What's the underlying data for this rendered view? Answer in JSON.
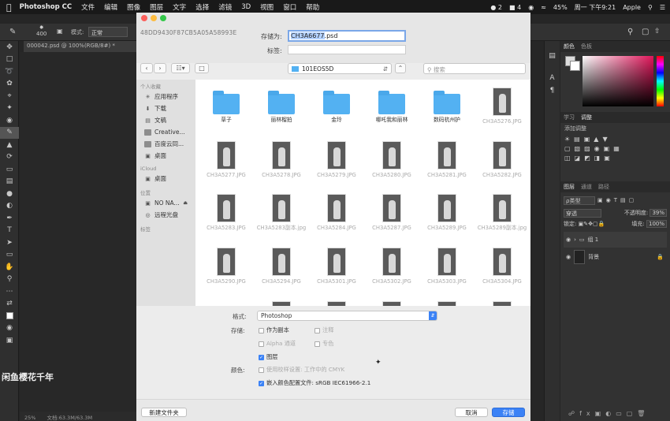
{
  "menubar": {
    "app": "Photoshop CC",
    "items": [
      "文件",
      "编辑",
      "图像",
      "图层",
      "文字",
      "选择",
      "滤镜",
      "3D",
      "视图",
      "窗口",
      "帮助"
    ],
    "status_badge_1": "2",
    "status_badge_2": "4",
    "battery": "45%",
    "clock": "周一 下午9:21",
    "user": "Apple"
  },
  "options_bar": {
    "size": "400",
    "mode_label": "模式:",
    "mode_value": "正常"
  },
  "document_tab": "000042.psd @ 100%(RGB/8#) *",
  "statusbar": {
    "zoom": "25%",
    "doc_size": "文档:63.3M/63.3M"
  },
  "watermark": "闲鱼樱花千年",
  "panels": {
    "color_tab": "颜色",
    "swatches_tab": "色板",
    "learn_tab": "学习",
    "adjust_tab": "调整",
    "adjust_title": "添加调整",
    "layers_tab": "图层",
    "channels_tab": "通道",
    "paths_tab": "路径",
    "kind": "ρ类型",
    "blend": "穿透",
    "opacity_label": "不透明度:",
    "opacity": "39%",
    "lock_label": "锁定:",
    "fill_label": "填充:",
    "fill": "100%",
    "layer_group": "组 1",
    "layer_bg": "背景"
  },
  "dialog": {
    "hash": "48DD9430F87CB5A05A58993E",
    "saveas_label": "存储为:",
    "filename_sel": "CH3A6677",
    "filename_ext": ".psd",
    "tags_label": "标签:",
    "location": "101EOS5D",
    "search_placeholder": "搜索",
    "sidebar": {
      "favorites": "个人收藏",
      "items": [
        "应用程序",
        "下载",
        "文稿",
        "Creative...",
        "百度云同...",
        "桌面"
      ],
      "icloud": "iCloud",
      "icloud_items": [
        "桌面"
      ],
      "locations": "位置",
      "location_items": [
        "NO NA...",
        "远程光盘"
      ],
      "tags": "标签"
    },
    "files": [
      {
        "name": "草子",
        "type": "folder"
      },
      {
        "name": "丽林榴拍",
        "type": "folder"
      },
      {
        "name": "金玲",
        "type": "folder"
      },
      {
        "name": "哪吒我和丽林",
        "type": "folder"
      },
      {
        "name": "数码杭州护",
        "type": "folder"
      },
      {
        "name": "CH3A5276.JPG",
        "type": "image"
      },
      {
        "name": "CH3A5277.JPG",
        "type": "image"
      },
      {
        "name": "CH3A5278.JPG",
        "type": "image"
      },
      {
        "name": "CH3A5279.JPG",
        "type": "image"
      },
      {
        "name": "CH3A5280.JPG",
        "type": "image"
      },
      {
        "name": "CH3A5281.JPG",
        "type": "image"
      },
      {
        "name": "CH3A5282.JPG",
        "type": "image"
      },
      {
        "name": "CH3A5283.JPG",
        "type": "image"
      },
      {
        "name": "CH3A5283副本.jpg",
        "type": "image"
      },
      {
        "name": "CH3A5284.JPG",
        "type": "image"
      },
      {
        "name": "CH3A5287.JPG",
        "type": "image"
      },
      {
        "name": "CH3A5289.JPG",
        "type": "image"
      },
      {
        "name": "CH3A5289副本.jpg",
        "type": "image"
      },
      {
        "name": "CH3A5290.JPG",
        "type": "image"
      },
      {
        "name": "CH3A5294.JPG",
        "type": "image"
      },
      {
        "name": "CH3A5301.JPG",
        "type": "image"
      },
      {
        "name": "CH3A5302.JPG",
        "type": "image"
      },
      {
        "name": "CH3A5303.JPG",
        "type": "image"
      },
      {
        "name": "CH3A5304.JPG",
        "type": "image"
      }
    ],
    "format_label": "格式:",
    "format_value": "Photoshop",
    "save_label": "存储:",
    "as_copy": "作为副本",
    "notes": "注释",
    "alpha": "Alpha 通道",
    "spot": "专色",
    "layers": "图层",
    "color_label": "颜色:",
    "proof": "使用校样设置: 工作中的 CMYK",
    "embed": "嵌入颜色配置文件: sRGB IEC61966-2.1",
    "new_folder": "新建文件夹",
    "cancel": "取消",
    "save": "存储"
  }
}
